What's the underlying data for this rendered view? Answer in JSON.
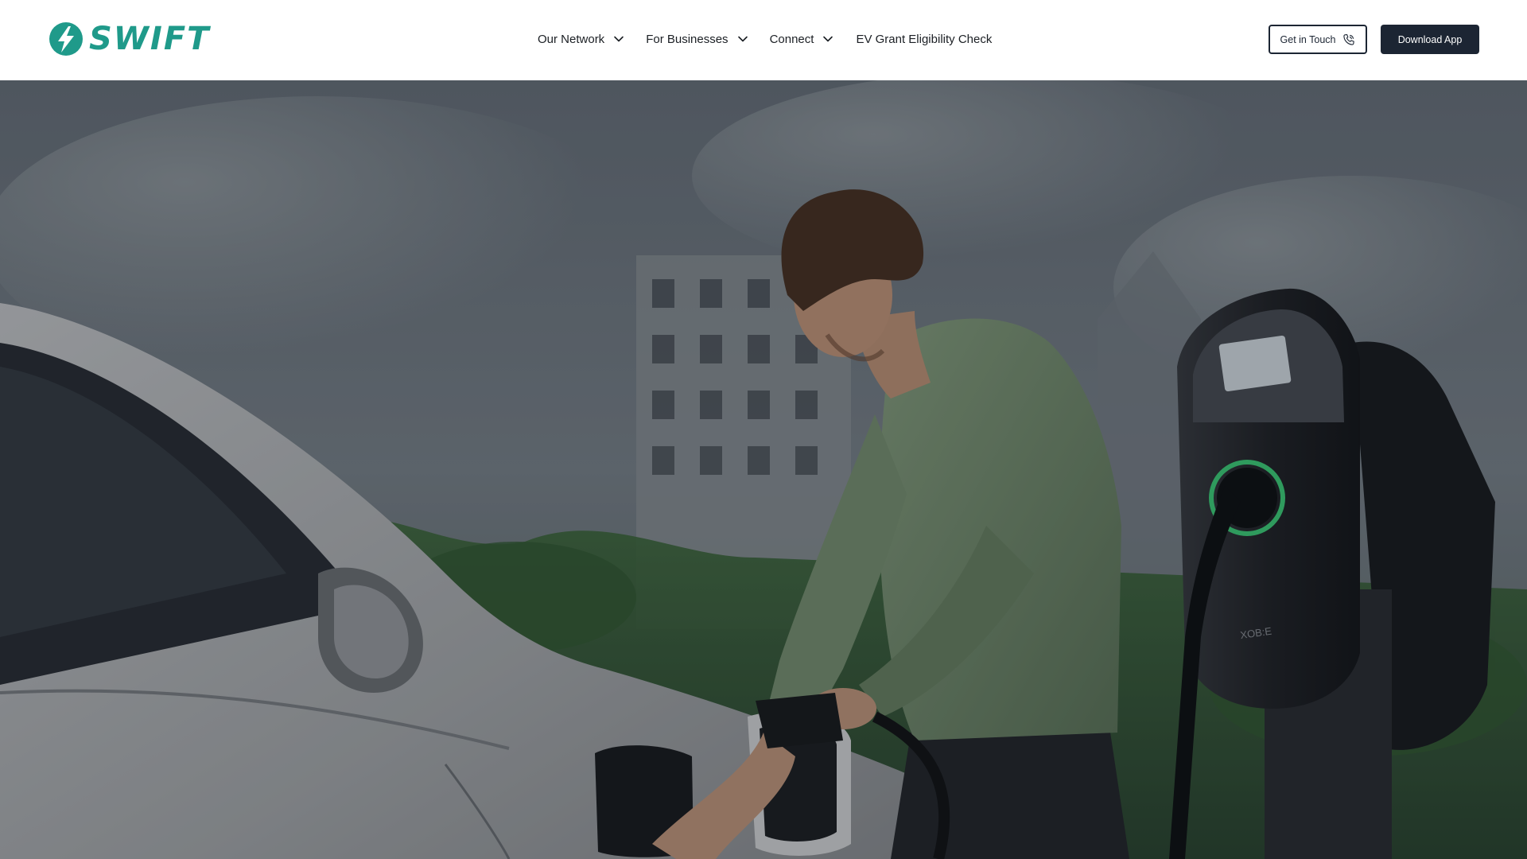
{
  "brand": {
    "name": "SWIFT",
    "primary_color": "#1f9a8a",
    "logo_icon": "lightning-bolt-icon"
  },
  "nav": {
    "items": [
      {
        "label": "Our Network",
        "has_dropdown": true
      },
      {
        "label": "For Businesses",
        "has_dropdown": true
      },
      {
        "label": "Connect",
        "has_dropdown": true
      },
      {
        "label": "EV Grant Eligibility Check",
        "has_dropdown": false
      }
    ]
  },
  "header_actions": {
    "get_in_touch_label": "Get in Touch",
    "get_in_touch_icon": "phone-icon",
    "download_app_label": "Download App",
    "dark_button_color": "#1c2533"
  },
  "hero": {
    "charger_brand": "XOB:E"
  }
}
